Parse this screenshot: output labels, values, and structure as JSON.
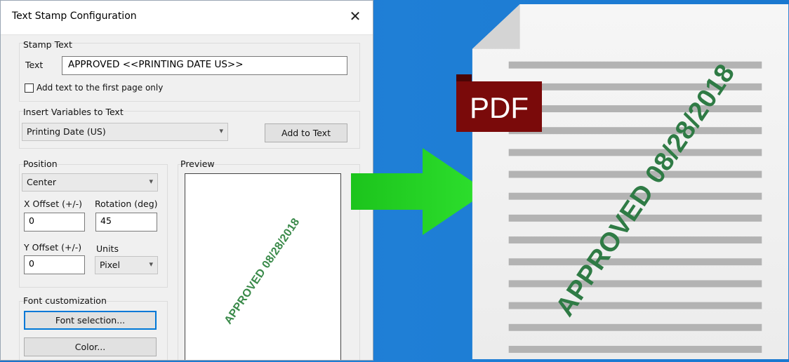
{
  "dialog": {
    "title": "Text Stamp Configuration",
    "close_glyph": "✕",
    "stamp_text": {
      "group_label": "Stamp Text",
      "text_label": "Text",
      "text_value": "APPROVED <<PRINTING DATE US>>",
      "first_page_only_label": "Add text to the first page only",
      "first_page_only_checked": false
    },
    "variables": {
      "group_label": "Insert Variables to Text",
      "selected": "Printing Date (US)",
      "add_button": "Add to Text"
    },
    "position": {
      "group_label": "Position",
      "selected": "Center",
      "x_offset_label": "X Offset (+/-)",
      "x_offset_value": "0",
      "rotation_label": "Rotation (deg)",
      "rotation_value": "45",
      "y_offset_label": "Y Offset (+/-)",
      "y_offset_value": "0",
      "units_label": "Units",
      "units_selected": "Pixel"
    },
    "preview": {
      "group_label": "Preview",
      "stamp_text": "APPROVED 08/28/2018"
    },
    "font": {
      "group_label": "Font customization",
      "font_button": "Font selection...",
      "color_button": "Color..."
    }
  },
  "document": {
    "badge": "PDF",
    "stamp_text": "APPROVED 08/28/2018",
    "stamp_color": "#2f7b45",
    "badge_color": "#7a0a0a"
  },
  "colors": {
    "background_blue": "#1f7fd6",
    "arrow_green": "#22d622"
  }
}
